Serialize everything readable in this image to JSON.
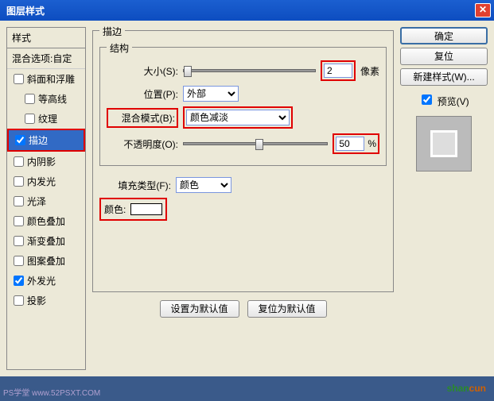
{
  "title": "图层样式",
  "styles_panel": {
    "header": "样式",
    "blend_opts": "混合选项:自定",
    "items": [
      {
        "label": "斜面和浮雕",
        "checked": false,
        "selected": false
      },
      {
        "label": "等高线",
        "checked": false,
        "selected": false,
        "indent": true
      },
      {
        "label": "纹理",
        "checked": false,
        "selected": false,
        "indent": true
      },
      {
        "label": "描边",
        "checked": true,
        "selected": true
      },
      {
        "label": "内阴影",
        "checked": false,
        "selected": false
      },
      {
        "label": "内发光",
        "checked": false,
        "selected": false
      },
      {
        "label": "光泽",
        "checked": false,
        "selected": false
      },
      {
        "label": "颜色叠加",
        "checked": false,
        "selected": false
      },
      {
        "label": "渐变叠加",
        "checked": false,
        "selected": false
      },
      {
        "label": "图案叠加",
        "checked": false,
        "selected": false
      },
      {
        "label": "外发光",
        "checked": true,
        "selected": false
      },
      {
        "label": "投影",
        "checked": false,
        "selected": false
      }
    ]
  },
  "settings": {
    "panel_title": "描边",
    "group_title": "结构",
    "size_label": "大小(S):",
    "size_value": "2",
    "size_unit": "像素",
    "position_label": "位置(P):",
    "position_value": "外部",
    "blend_label": "混合模式(B):",
    "blend_value": "颜色减淡",
    "opacity_label": "不透明度(O):",
    "opacity_value": "50",
    "opacity_unit": "%",
    "filltype_label": "填充类型(F):",
    "filltype_value": "颜色",
    "color_label": "颜色:",
    "default_btn": "设置为默认值",
    "reset_btn": "复位为默认值"
  },
  "right": {
    "ok": "确定",
    "reset": "复位",
    "new_style": "新建样式(W)...",
    "preview_label": "预览(V)"
  },
  "watermark_left": "PS学堂   www.52PSXT.COM",
  "watermark_right_1": "shan",
  "watermark_right_2": "cun"
}
